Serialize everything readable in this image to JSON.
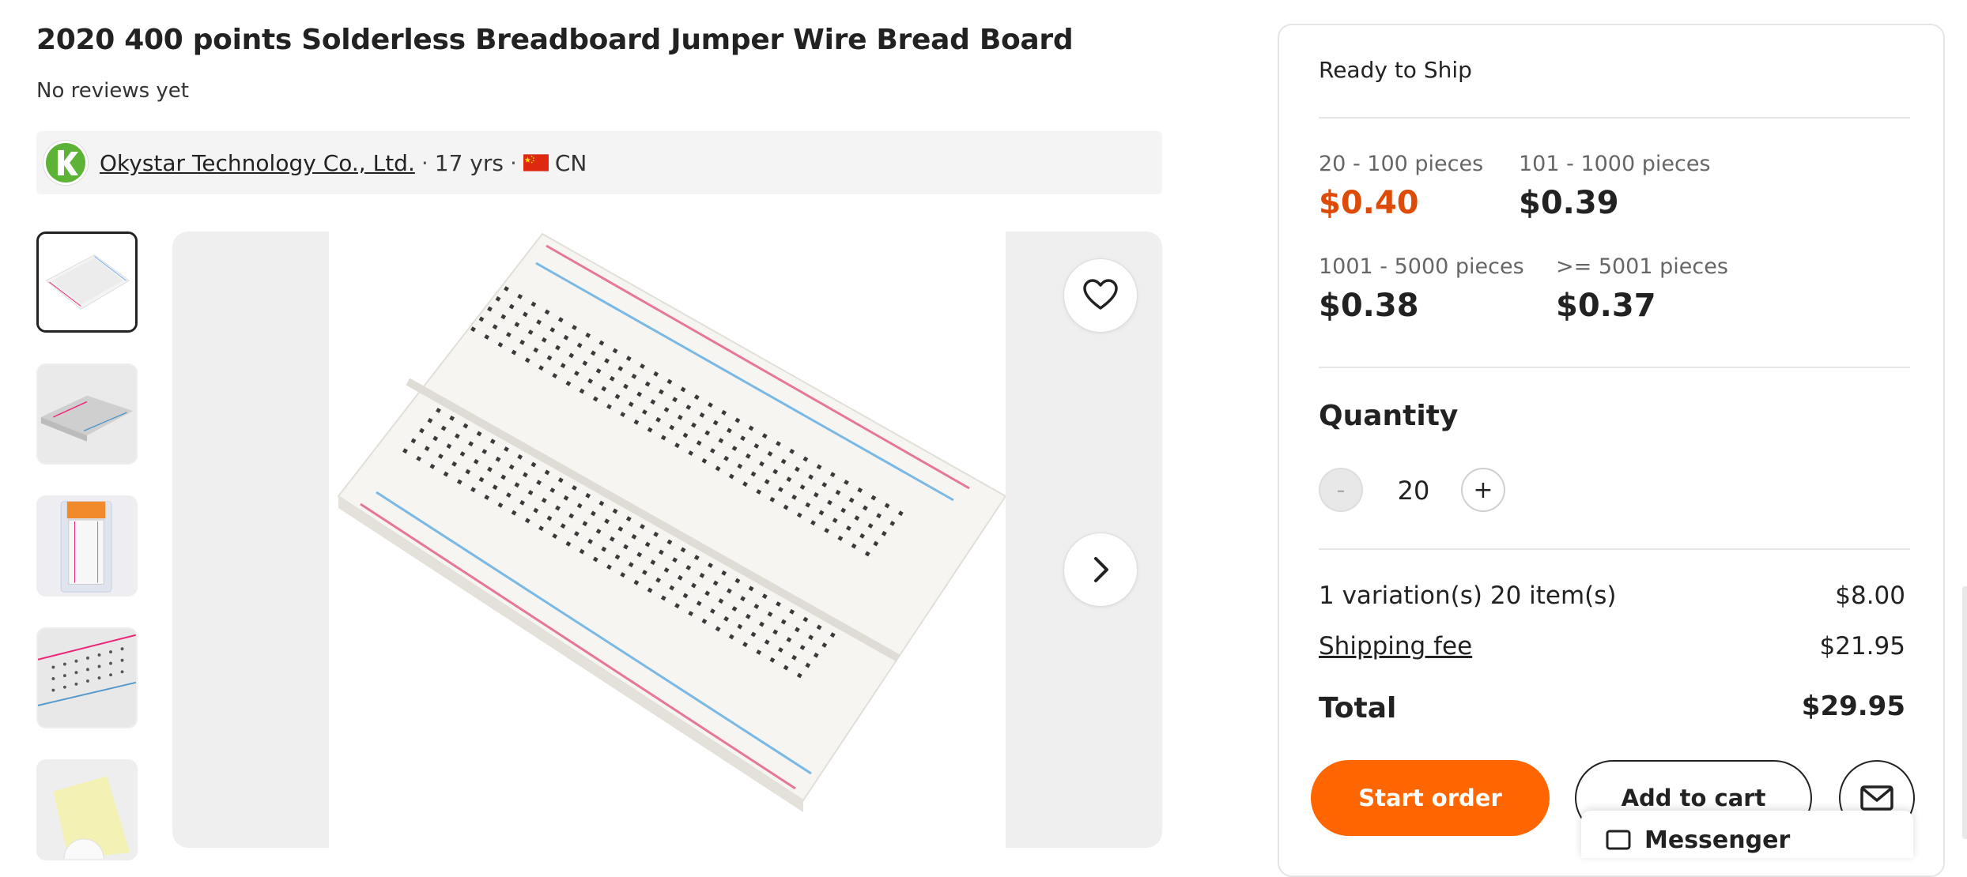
{
  "product": {
    "title": "2020 400 points Solderless Breadboard Jumper Wire Bread Board",
    "reviews": "No reviews yet"
  },
  "supplier": {
    "name": "Okystar Technology Co., Ltd.",
    "sep1": "·",
    "years": "17 yrs",
    "sep2": "·",
    "country": "CN",
    "logo_icon": "okystar-logo",
    "flag_icon": "china-flag-icon"
  },
  "gallery": {
    "thumbnails": [
      "breadboard-angle",
      "breadboard-side",
      "breadboard-package",
      "breadboard-closeup",
      "jumper-wire-pack"
    ],
    "selected_index": 0,
    "favorite_icon": "heart-icon",
    "next_icon": "chevron-right-icon"
  },
  "order_panel": {
    "ready": "Ready to Ship",
    "tiers": [
      {
        "range": "20 - 100 pieces",
        "price": "$0.40"
      },
      {
        "range": "101 - 1000 pieces",
        "price": "$0.39"
      },
      {
        "range": "1001 - 5000 pieces",
        "price": "$0.38"
      },
      {
        "range": ">= 5001 pieces",
        "price": "$0.37"
      }
    ],
    "quantity_label": "Quantity",
    "quantity_value": "20",
    "minus": "-",
    "plus": "+",
    "variation_label": "1 variation(s) 20 item(s)",
    "variation_value": "$8.00",
    "shipping_label": "Shipping fee",
    "shipping_value": "$21.95",
    "total_label": "Total",
    "total_value": "$29.95"
  },
  "actions": {
    "start_order": "Start order",
    "add_to_cart": "Add to cart",
    "message_icon": "mail-icon"
  },
  "messenger": {
    "label": "Messenger",
    "icon": "chat-icon"
  },
  "colors": {
    "accent_price": "#de4b06",
    "start_button": "#ff6600"
  }
}
